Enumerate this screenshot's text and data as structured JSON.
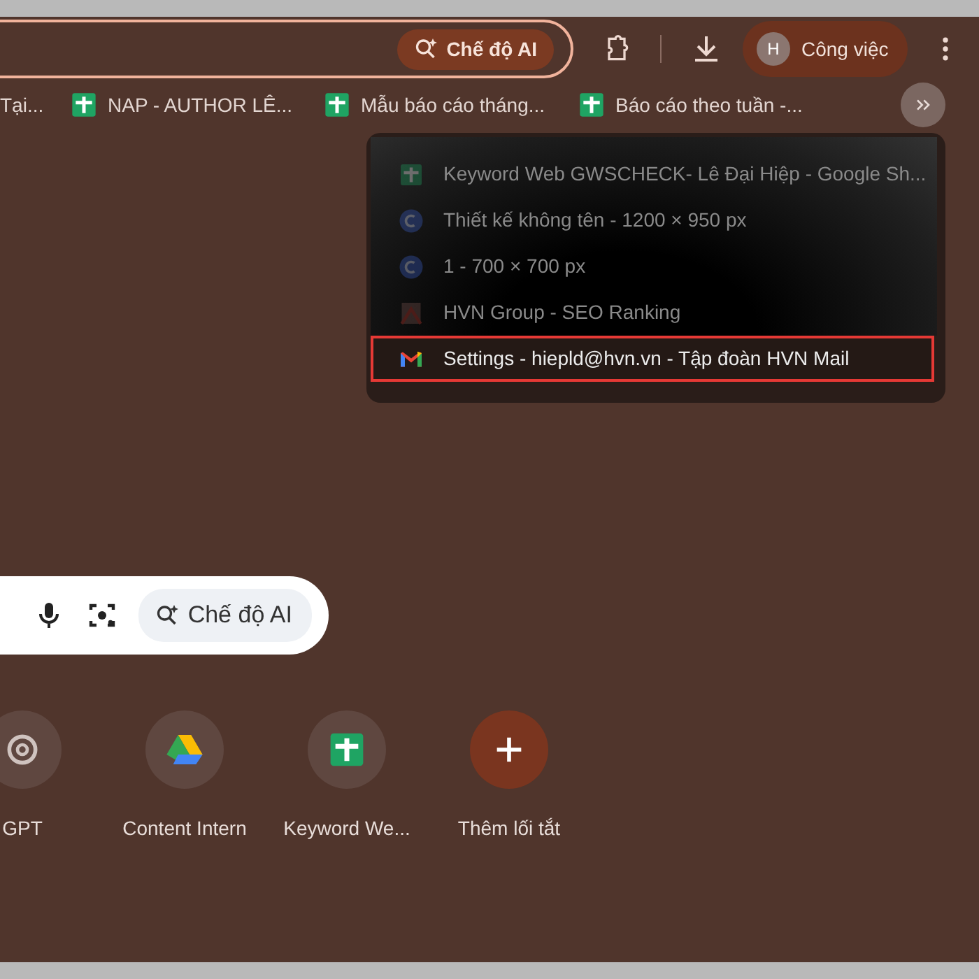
{
  "toolbar": {
    "ai_mode_chip": "Chế độ AI",
    "profile": {
      "initial": "H",
      "name": "Công việc"
    }
  },
  "bookmarks": [
    {
      "kind": "none",
      "label": "Tại..."
    },
    {
      "kind": "sheets",
      "label": "NAP - AUTHOR LÊ..."
    },
    {
      "kind": "sheets",
      "label": "Mẫu báo cáo tháng..."
    },
    {
      "kind": "sheets",
      "label": "Báo cáo theo tuần -..."
    }
  ],
  "overflow_menu": {
    "items": [
      {
        "kind": "sheets",
        "label": "Keyword Web GWSCHECK- Lê Đại Hiệp - Google Sh...",
        "highlighted": false
      },
      {
        "kind": "canva",
        "label": "Thiết kế không tên - 1200 × 950 px",
        "highlighted": false
      },
      {
        "kind": "canva",
        "label": "1 - 700 × 700 px",
        "highlighted": false
      },
      {
        "kind": "ranking",
        "label": "HVN Group - SEO Ranking",
        "highlighted": false
      },
      {
        "kind": "gmail",
        "label": "Settings - hiepld@hvn.vn - Tập đoàn HVN Mail",
        "highlighted": true
      }
    ]
  },
  "search": {
    "ai_mode_chip": "Chế độ AI"
  },
  "shortcuts": [
    {
      "kind": "chatgpt",
      "label": "GPT"
    },
    {
      "kind": "drive",
      "label": "Content Intern"
    },
    {
      "kind": "sheets",
      "label": "Keyword We..."
    },
    {
      "kind": "add",
      "label": "Thêm lối tắt"
    }
  ]
}
